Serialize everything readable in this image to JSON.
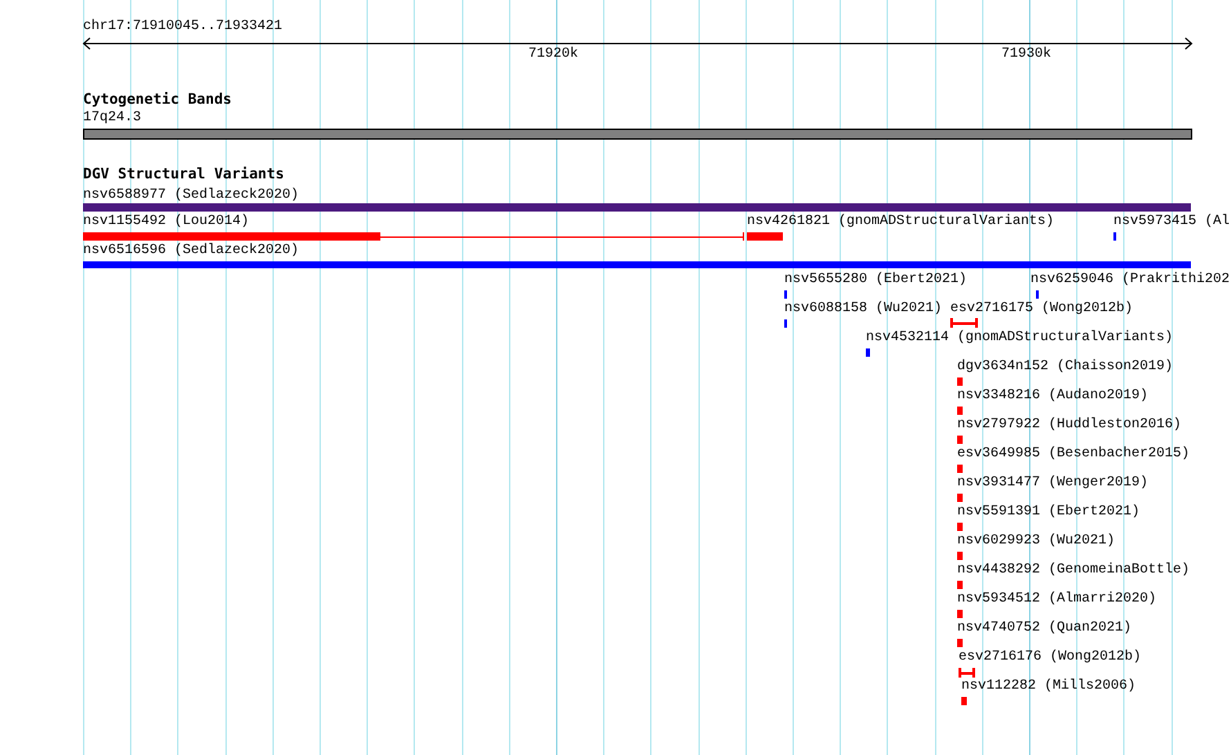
{
  "ruler": {
    "location": "chr17:71910045..71933421",
    "ticks": [
      "71920k",
      "71930k"
    ]
  },
  "tracks": [
    {
      "title": "Cytogenetic Bands",
      "kind": "cytoband",
      "features": [
        {
          "label": "17q24.3",
          "color": "#808080",
          "kind": "bar"
        }
      ]
    },
    {
      "title": "DGV Structural Variants",
      "kind": "variants",
      "features": [
        {
          "label": "nsv6588977 (Sedlazeck2020)",
          "color": "#4b1a7f",
          "kind": "bar"
        },
        {
          "label": "nsv1155492 (Lou2014)",
          "color": "#ff0000",
          "kind": "split"
        },
        {
          "label": "nsv4261821 (gnomADStructuralVariants)",
          "color": "#ff0000",
          "kind": "bar"
        },
        {
          "label": "nsv5973415 (Al",
          "color": "#0000ff",
          "kind": "bar"
        },
        {
          "label": "nsv6516596 (Sedlazeck2020)",
          "color": "#0000ff",
          "kind": "bar"
        },
        {
          "label": "nsv5655280 (Ebert2021)",
          "color": "#0000ff",
          "kind": "bar"
        },
        {
          "label": "nsv6259046 (Prakrithi202",
          "color": "#0000ff",
          "kind": "bar"
        },
        {
          "label": "nsv6088158 (Wu2021)",
          "color": "#0000ff",
          "kind": "bar"
        },
        {
          "label": "esv2716175 (Wong2012b)",
          "color": "#ff0000",
          "kind": "interval"
        },
        {
          "label": "nsv4532114 (gnomADStructuralVariants)",
          "color": "#0000ff",
          "kind": "bar"
        },
        {
          "label": "dgv3634n152 (Chaisson2019)",
          "color": "#ff0000",
          "kind": "bar"
        },
        {
          "label": "nsv3348216 (Audano2019)",
          "color": "#ff0000",
          "kind": "bar"
        },
        {
          "label": "nsv2797922 (Huddleston2016)",
          "color": "#ff0000",
          "kind": "bar"
        },
        {
          "label": "esv3649985 (Besenbacher2015)",
          "color": "#ff0000",
          "kind": "bar"
        },
        {
          "label": "nsv3931477 (Wenger2019)",
          "color": "#ff0000",
          "kind": "bar"
        },
        {
          "label": "nsv5591391 (Ebert2021)",
          "color": "#ff0000",
          "kind": "bar"
        },
        {
          "label": "nsv6029923 (Wu2021)",
          "color": "#ff0000",
          "kind": "bar"
        },
        {
          "label": "nsv4438292 (GenomeinaBottle)",
          "color": "#ff0000",
          "kind": "bar"
        },
        {
          "label": "nsv5934512 (Almarri2020)",
          "color": "#ff0000",
          "kind": "bar"
        },
        {
          "label": "nsv4740752 (Quan2021)",
          "color": "#ff0000",
          "kind": "bar"
        },
        {
          "label": "esv2716176 (Wong2012b)",
          "color": "#ff0000",
          "kind": "interval"
        },
        {
          "label": "nsv112282 (Mills2006)",
          "color": "#ff0000",
          "kind": "bar"
        }
      ]
    }
  ]
}
